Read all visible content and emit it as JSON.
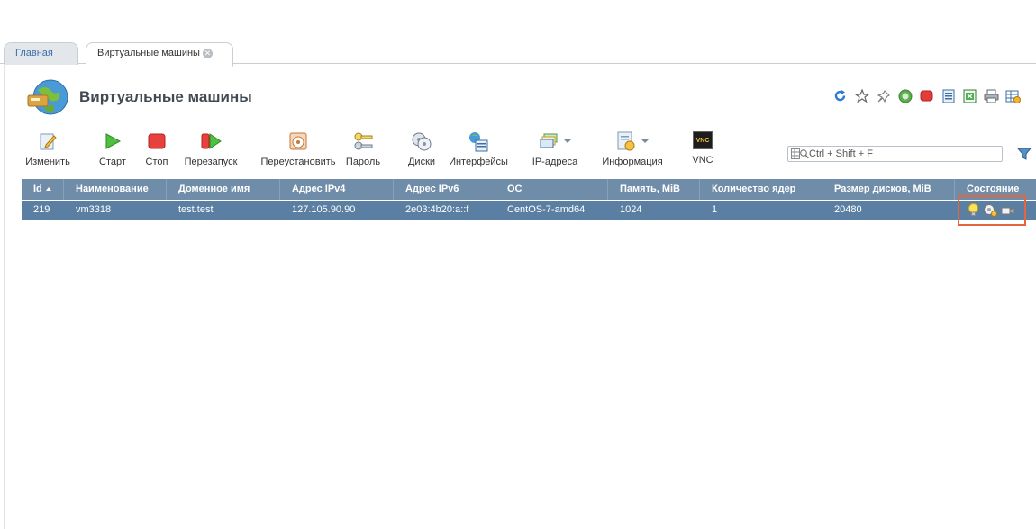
{
  "tabs": [
    {
      "label": "Главная"
    },
    {
      "label": "Виртуальные машины"
    }
  ],
  "page": {
    "title": "Виртуальные машины"
  },
  "header_icons": [
    "refresh-icon",
    "star-icon",
    "pin-icon",
    "globe-status-icon",
    "red-stop-icon",
    "document-icon",
    "excel-icon",
    "print-icon",
    "table-settings-icon"
  ],
  "toolbar": {
    "edit": "Изменить",
    "start": "Старт",
    "stop": "Стоп",
    "restart": "Перезапуск",
    "reinstall": "Переустановить",
    "password": "Пароль",
    "disks": "Диски",
    "interfaces": "Интерфейсы",
    "ip": "IP-адреса",
    "info": "Информация",
    "vnc": "VNC",
    "vnc_icon_text": "VNC"
  },
  "search": {
    "placeholder": "Ctrl + Shift + F"
  },
  "table": {
    "columns": [
      "Id",
      "Наименование",
      "Доменное имя",
      "Адрес IPv4",
      "Адрес IPv6",
      "ОС",
      "Память, MiB",
      "Количество ядер",
      "Размер дисков, MiB",
      "Состояние"
    ],
    "rows": [
      {
        "id": "219",
        "name": "vm3318",
        "domain": "test.test",
        "ipv4": "127.105.90.90",
        "ipv6": "2e03:4b20:a::f",
        "os": "CentOS-7-amd64",
        "memory": "1024",
        "cores": "1",
        "disk": "20480"
      }
    ]
  },
  "colors": {
    "header": "#6f8da9",
    "selected_row": "#5b7fa3",
    "highlight": "#e3663c"
  }
}
